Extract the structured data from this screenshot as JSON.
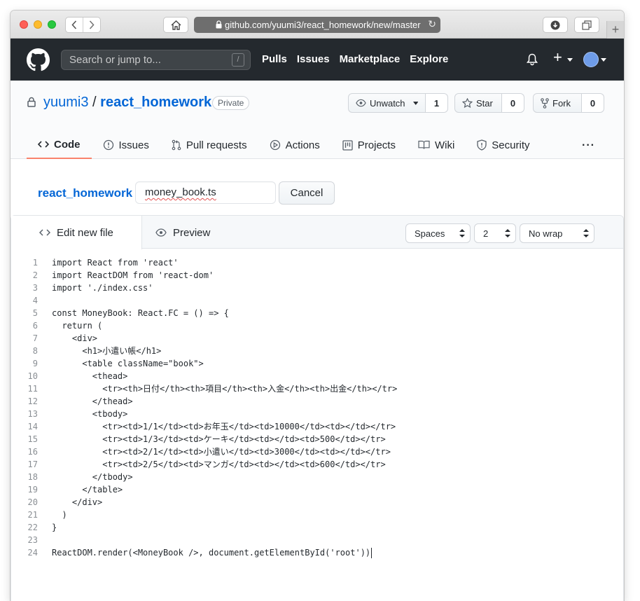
{
  "browser": {
    "url": "github.com/yuumi3/react_homework/new/master"
  },
  "header": {
    "search_placeholder": "Search or jump to...",
    "search_shortcut": "/",
    "nav": [
      "Pulls",
      "Issues",
      "Marketplace",
      "Explore"
    ]
  },
  "repo": {
    "owner": "yuumi3",
    "separator": "/",
    "name": "react_homework",
    "visibility": "Private",
    "watch_label": "Unwatch",
    "watch_count": "1",
    "star_label": "Star",
    "star_count": "0",
    "fork_label": "Fork",
    "fork_count": "0",
    "tabs": [
      {
        "label": "Code",
        "icon": "code-icon",
        "selected": true
      },
      {
        "label": "Issues",
        "icon": "issue-icon",
        "selected": false
      },
      {
        "label": "Pull requests",
        "icon": "pull-request-icon",
        "selected": false
      },
      {
        "label": "Actions",
        "icon": "play-icon",
        "selected": false
      },
      {
        "label": "Projects",
        "icon": "project-icon",
        "selected": false
      },
      {
        "label": "Wiki",
        "icon": "book-icon",
        "selected": false
      },
      {
        "label": "Security",
        "icon": "shield-icon",
        "selected": false
      }
    ],
    "more": "···"
  },
  "breadcrumb": {
    "root": "react_homework",
    "separator": "/",
    "filename": "money_book.ts",
    "cancel_label": "Cancel"
  },
  "editor": {
    "edit_tab": "Edit new file",
    "preview_tab": "Preview",
    "indent_mode": "Spaces",
    "indent_size": "2",
    "wrap_mode": "No wrap",
    "lines": [
      "import React from 'react'",
      "import ReactDOM from 'react-dom'",
      "import './index.css'",
      "",
      "const MoneyBook: React.FC = () => {",
      "  return (",
      "    <div>",
      "      <h1>小遣い帳</h1>",
      "      <table className=\"book\">",
      "        <thead>",
      "          <tr><th>日付</th><th>項目</th><th>入金</th><th>出金</th></tr>",
      "        </thead>",
      "        <tbody>",
      "          <tr><td>1/1</td><td>お年玉</td><td>10000</td><td></td></tr>",
      "          <tr><td>1/3</td><td>ケーキ</td><td></td><td>500</td></tr>",
      "          <tr><td>2/1</td><td>小遣い</td><td>3000</td><td></td></tr>",
      "          <tr><td>2/5</td><td>マンガ</td><td></td><td>600</td></tr>",
      "        </tbody>",
      "      </table>",
      "    </div>",
      "  )",
      "}",
      "",
      "ReactDOM.render(<MoneyBook />, document.getElementById('root'))"
    ]
  }
}
